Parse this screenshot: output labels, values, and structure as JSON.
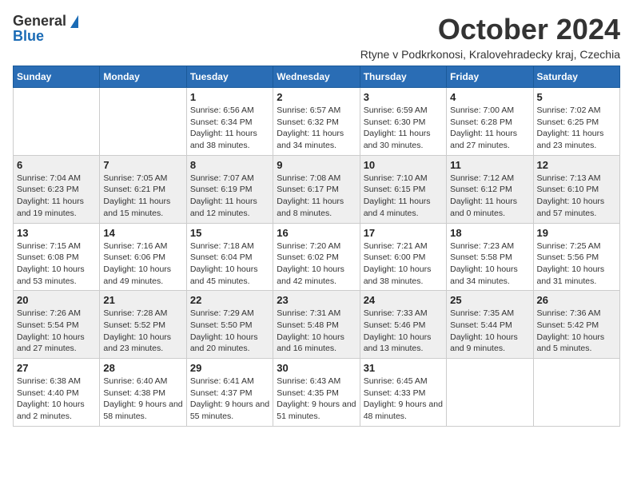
{
  "header": {
    "logo_general": "General",
    "logo_blue": "Blue",
    "title": "October 2024",
    "location": "Rtyne v Podkrkonosi, Kralovehradecky kraj, Czechia"
  },
  "calendar": {
    "days_of_week": [
      "Sunday",
      "Monday",
      "Tuesday",
      "Wednesday",
      "Thursday",
      "Friday",
      "Saturday"
    ],
    "weeks": [
      [
        {
          "day": "",
          "info": ""
        },
        {
          "day": "",
          "info": ""
        },
        {
          "day": "1",
          "info": "Sunrise: 6:56 AM\nSunset: 6:34 PM\nDaylight: 11 hours and 38 minutes."
        },
        {
          "day": "2",
          "info": "Sunrise: 6:57 AM\nSunset: 6:32 PM\nDaylight: 11 hours and 34 minutes."
        },
        {
          "day": "3",
          "info": "Sunrise: 6:59 AM\nSunset: 6:30 PM\nDaylight: 11 hours and 30 minutes."
        },
        {
          "day": "4",
          "info": "Sunrise: 7:00 AM\nSunset: 6:28 PM\nDaylight: 11 hours and 27 minutes."
        },
        {
          "day": "5",
          "info": "Sunrise: 7:02 AM\nSunset: 6:25 PM\nDaylight: 11 hours and 23 minutes."
        }
      ],
      [
        {
          "day": "6",
          "info": "Sunrise: 7:04 AM\nSunset: 6:23 PM\nDaylight: 11 hours and 19 minutes."
        },
        {
          "day": "7",
          "info": "Sunrise: 7:05 AM\nSunset: 6:21 PM\nDaylight: 11 hours and 15 minutes."
        },
        {
          "day": "8",
          "info": "Sunrise: 7:07 AM\nSunset: 6:19 PM\nDaylight: 11 hours and 12 minutes."
        },
        {
          "day": "9",
          "info": "Sunrise: 7:08 AM\nSunset: 6:17 PM\nDaylight: 11 hours and 8 minutes."
        },
        {
          "day": "10",
          "info": "Sunrise: 7:10 AM\nSunset: 6:15 PM\nDaylight: 11 hours and 4 minutes."
        },
        {
          "day": "11",
          "info": "Sunrise: 7:12 AM\nSunset: 6:12 PM\nDaylight: 11 hours and 0 minutes."
        },
        {
          "day": "12",
          "info": "Sunrise: 7:13 AM\nSunset: 6:10 PM\nDaylight: 10 hours and 57 minutes."
        }
      ],
      [
        {
          "day": "13",
          "info": "Sunrise: 7:15 AM\nSunset: 6:08 PM\nDaylight: 10 hours and 53 minutes."
        },
        {
          "day": "14",
          "info": "Sunrise: 7:16 AM\nSunset: 6:06 PM\nDaylight: 10 hours and 49 minutes."
        },
        {
          "day": "15",
          "info": "Sunrise: 7:18 AM\nSunset: 6:04 PM\nDaylight: 10 hours and 45 minutes."
        },
        {
          "day": "16",
          "info": "Sunrise: 7:20 AM\nSunset: 6:02 PM\nDaylight: 10 hours and 42 minutes."
        },
        {
          "day": "17",
          "info": "Sunrise: 7:21 AM\nSunset: 6:00 PM\nDaylight: 10 hours and 38 minutes."
        },
        {
          "day": "18",
          "info": "Sunrise: 7:23 AM\nSunset: 5:58 PM\nDaylight: 10 hours and 34 minutes."
        },
        {
          "day": "19",
          "info": "Sunrise: 7:25 AM\nSunset: 5:56 PM\nDaylight: 10 hours and 31 minutes."
        }
      ],
      [
        {
          "day": "20",
          "info": "Sunrise: 7:26 AM\nSunset: 5:54 PM\nDaylight: 10 hours and 27 minutes."
        },
        {
          "day": "21",
          "info": "Sunrise: 7:28 AM\nSunset: 5:52 PM\nDaylight: 10 hours and 23 minutes."
        },
        {
          "day": "22",
          "info": "Sunrise: 7:29 AM\nSunset: 5:50 PM\nDaylight: 10 hours and 20 minutes."
        },
        {
          "day": "23",
          "info": "Sunrise: 7:31 AM\nSunset: 5:48 PM\nDaylight: 10 hours and 16 minutes."
        },
        {
          "day": "24",
          "info": "Sunrise: 7:33 AM\nSunset: 5:46 PM\nDaylight: 10 hours and 13 minutes."
        },
        {
          "day": "25",
          "info": "Sunrise: 7:35 AM\nSunset: 5:44 PM\nDaylight: 10 hours and 9 minutes."
        },
        {
          "day": "26",
          "info": "Sunrise: 7:36 AM\nSunset: 5:42 PM\nDaylight: 10 hours and 5 minutes."
        }
      ],
      [
        {
          "day": "27",
          "info": "Sunrise: 6:38 AM\nSunset: 4:40 PM\nDaylight: 10 hours and 2 minutes."
        },
        {
          "day": "28",
          "info": "Sunrise: 6:40 AM\nSunset: 4:38 PM\nDaylight: 9 hours and 58 minutes."
        },
        {
          "day": "29",
          "info": "Sunrise: 6:41 AM\nSunset: 4:37 PM\nDaylight: 9 hours and 55 minutes."
        },
        {
          "day": "30",
          "info": "Sunrise: 6:43 AM\nSunset: 4:35 PM\nDaylight: 9 hours and 51 minutes."
        },
        {
          "day": "31",
          "info": "Sunrise: 6:45 AM\nSunset: 4:33 PM\nDaylight: 9 hours and 48 minutes."
        },
        {
          "day": "",
          "info": ""
        },
        {
          "day": "",
          "info": ""
        }
      ]
    ]
  }
}
